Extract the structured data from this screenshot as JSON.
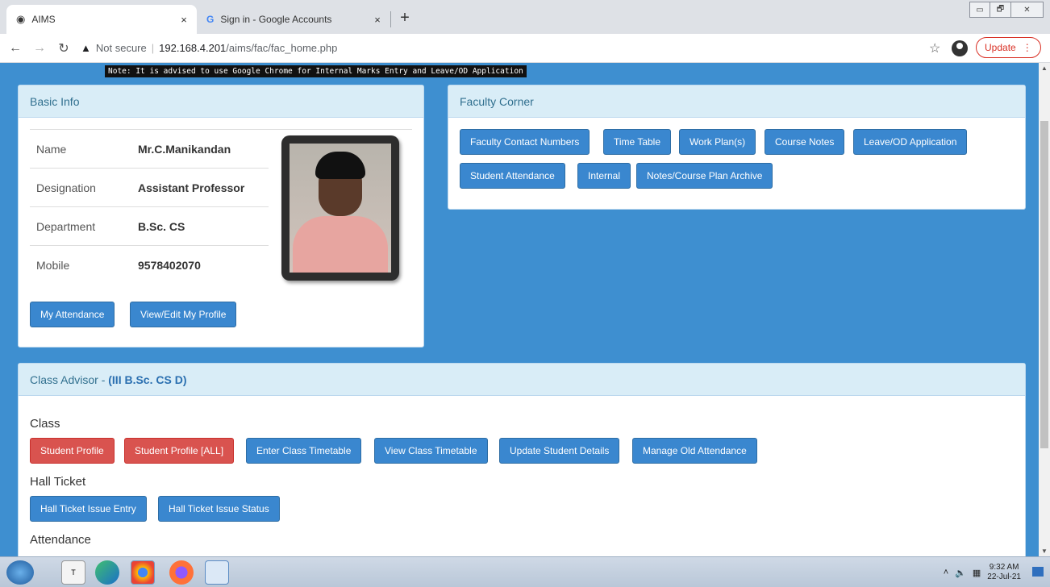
{
  "browser": {
    "tabs": [
      {
        "title": "AIMS",
        "close": "×"
      },
      {
        "title": "Sign in - Google Accounts",
        "close": "×"
      }
    ],
    "new_tab": "+",
    "url_warning": "Not secure",
    "url_host": "192.168.4.201",
    "url_path": "/aims/fac/fac_home.php",
    "update_label": "Update",
    "window_controls": [
      "▭",
      "🗗",
      "✕"
    ]
  },
  "note": "Note: It is advised to use Google Chrome for Internal Marks Entry and Leave/OD Application",
  "basic_info": {
    "title": "Basic Info",
    "rows": [
      {
        "key": "Name",
        "value": "Mr.C.Manikandan"
      },
      {
        "key": "Designation",
        "value": "Assistant Professor"
      },
      {
        "key": "Department",
        "value": "B.Sc. CS"
      },
      {
        "key": "Mobile",
        "value": "9578402070"
      }
    ],
    "buttons": [
      "My Attendance",
      "View/Edit My Profile"
    ]
  },
  "faculty_corner": {
    "title": "Faculty Corner",
    "row1": [
      "Faculty Contact Numbers",
      "Time Table",
      "Work Plan(s)",
      "Course Notes",
      "Leave/OD Application"
    ],
    "row2": [
      "Student Attendance",
      "Internal",
      "Notes/Course Plan Archive"
    ]
  },
  "class_advisor": {
    "title_prefix": "Class Advisor - ",
    "title_class": "(III B.Sc. CS D)",
    "class_label": "Class",
    "class_buttons": [
      "Student Profile",
      "Student Profile [ALL]",
      "Enter Class Timetable",
      "View Class Timetable",
      "Update Student Details",
      "Manage Old Attendance"
    ],
    "hall_ticket_label": "Hall Ticket",
    "hall_ticket_buttons": [
      "Hall Ticket Issue Entry",
      "Hall Ticket Issue Status"
    ],
    "attendance_label": "Attendance"
  },
  "taskbar": {
    "time": "9:32 AM",
    "date": "22-Jul-21"
  },
  "colors": {
    "page_bg": "#3e8fd0",
    "button_blue": "#3a87cf",
    "button_red": "#d9534f",
    "panel_head": "#d9edf7"
  }
}
